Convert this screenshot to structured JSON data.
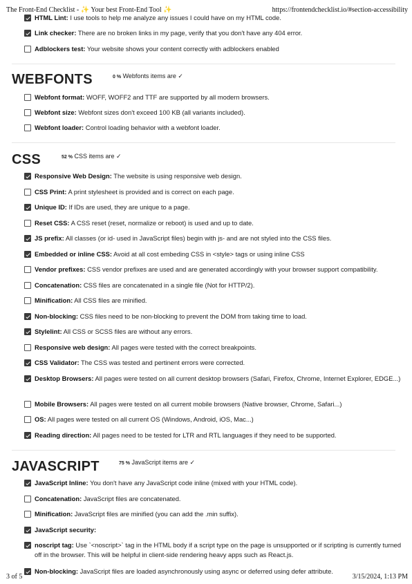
{
  "header": {
    "page_title": "The Front-End Checklist - ✨ Your best Front-End Tool ✨",
    "url": "https://frontendchecklist.io/#section-accessibility"
  },
  "footer": {
    "page_number": "3 of 5",
    "datetime": "3/15/2024, 1:13 PM"
  },
  "sections": {
    "top": {
      "items": [
        {
          "title": "HTML Lint:",
          "desc": " I use tools to help me analyze any issues I could have on my HTML code.",
          "checked": true
        },
        {
          "title": "Link checker:",
          "desc": " There are no broken links in my page, verify that you don't have any 404 error.",
          "checked": true
        },
        {
          "title": "Adblockers test:",
          "desc": " Your website shows your content correctly with adblockers enabled",
          "checked": false
        }
      ]
    },
    "webfonts": {
      "title": "WEBFONTS",
      "percent": "0 %",
      "stat_text": " Webfonts items are ✓",
      "items": [
        {
          "title": "Webfont format:",
          "desc": " WOFF, WOFF2 and TTF are supported by all modern browsers.",
          "checked": false
        },
        {
          "title": "Webfont size:",
          "desc": " Webfont sizes don't exceed 100 KB (all variants included).",
          "checked": false
        },
        {
          "title": "Webfont loader:",
          "desc": " Control loading behavior with a webfont loader.",
          "checked": false
        }
      ]
    },
    "css": {
      "title": "CSS",
      "percent": "52 %",
      "stat_text": " CSS items are ✓",
      "items": [
        {
          "title": "Responsive Web Design:",
          "desc": " The website is using responsive web design.",
          "checked": true
        },
        {
          "title": "CSS Print:",
          "desc": " A print stylesheet is provided and is correct on each page.",
          "checked": false
        },
        {
          "title": "Unique ID:",
          "desc": " If IDs are used, they are unique to a page.",
          "checked": true
        },
        {
          "title": "Reset CSS:",
          "desc": " A CSS reset (reset, normalize or reboot) is used and up to date.",
          "checked": false
        },
        {
          "title": "JS prefix:",
          "desc": " All classes (or id- used in JavaScript files) begin with js- and are not styled into the CSS files.",
          "checked": true
        },
        {
          "title": "Embedded or inline CSS:",
          "desc": " Avoid at all cost embeding CSS in <style> tags or using inline CSS",
          "checked": true
        },
        {
          "title": "Vendor prefixes:",
          "desc": " CSS vendor prefixes are used and are generated accordingly with your browser support compatibility.",
          "checked": false
        },
        {
          "title": "Concatenation:",
          "desc": " CSS files are concatenated in a single file (Not for HTTP/2).",
          "checked": false
        },
        {
          "title": "Minification:",
          "desc": " All CSS files are minified.",
          "checked": false
        },
        {
          "title": "Non-blocking:",
          "desc": " CSS files need to be non-blocking to prevent the DOM from taking time to load.",
          "checked": true
        },
        {
          "title": "Stylelint:",
          "desc": " All CSS or SCSS files are without any errors.",
          "checked": true
        },
        {
          "title": "Responsive web design:",
          "desc": " All pages were tested with the correct breakpoints.",
          "checked": false
        },
        {
          "title": "CSS Validator:",
          "desc": " The CSS was tested and pertinent errors were corrected.",
          "checked": true
        },
        {
          "title": "Desktop Browsers:",
          "desc": " All pages were tested on all current desktop browsers (Safari, Firefox, Chrome, Internet Explorer, EDGE...)",
          "checked": true
        },
        {
          "title": "Mobile Browsers:",
          "desc": " All pages were tested on all current mobile browsers (Native browser, Chrome, Safari...)",
          "checked": false
        },
        {
          "title": "OS:",
          "desc": " All pages were tested on all current OS (Windows, Android, iOS, Mac...)",
          "checked": false
        },
        {
          "title": "Reading direction:",
          "desc": " All pages need to be tested for LTR and RTL languages if they need to be supported.",
          "checked": true
        }
      ]
    },
    "javascript": {
      "title": "JAVASCRIPT",
      "percent": "75 %",
      "stat_text": " JavaScript items are ✓",
      "items": [
        {
          "title": "JavaScript Inline:",
          "desc": " You don't have any JavaScript code inline (mixed with your HTML code).",
          "checked": true
        },
        {
          "title": "Concatenation:",
          "desc": " JavaScript files are concatenated.",
          "checked": false
        },
        {
          "title": "Minification:",
          "desc": " JavaScript files are minified (you can add the .min suffix).",
          "checked": false
        },
        {
          "title": "JavaScript security:",
          "desc": "",
          "checked": true
        },
        {
          "title": "noscript tag:",
          "desc": " Use `<noscript>` tag in the HTML body if a script type on the page is unsupported or if scripting is currently turned off in the browser. This will be helpful in client-side rendering heavy apps such as React.js.",
          "checked": true
        },
        {
          "title": "Non-blocking:",
          "desc": " JavaScript files are loaded asynchronously using async or deferred using defer attribute.",
          "checked": true
        }
      ]
    }
  }
}
